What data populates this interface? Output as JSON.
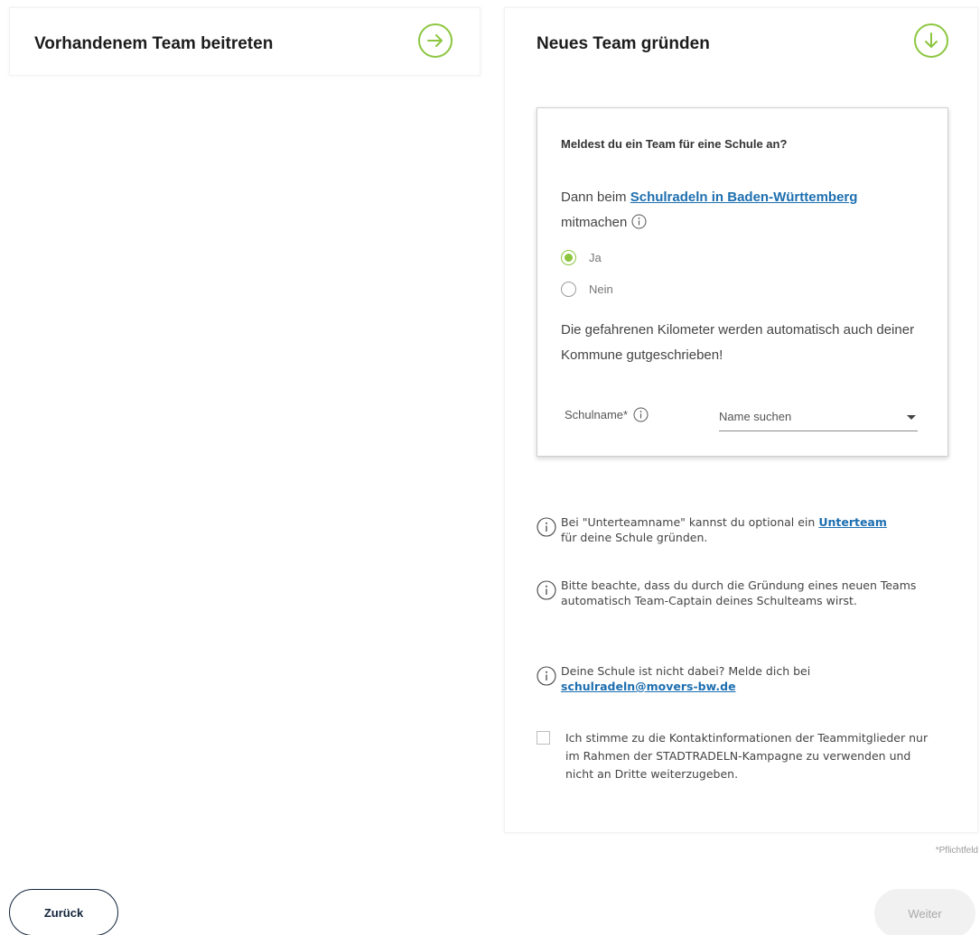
{
  "join_card": {
    "title": "Vorhandenem Team beitreten",
    "icon": "arrow-right-circle-icon"
  },
  "new_card": {
    "title": "Neues Team gründen",
    "icon": "arrow-down-circle-icon",
    "school_box": {
      "question": "Meldest du ein Team für eine Schule an?",
      "dann_prefix": "Dann beim",
      "dann_link": "Schulradeln in Baden-Württemberg",
      "dann_suffix": "mitmachen",
      "radio_options": [
        {
          "label": "Ja",
          "checked": true
        },
        {
          "label": "Nein",
          "checked": false
        }
      ],
      "km_text": "Die gefahrenen Kilometer werden automatisch auch deiner Kommune gutgeschrieben!",
      "school_label": "Schulname*",
      "school_placeholder": "Name suchen"
    },
    "notes": {
      "n1_prefix": "Bei \"Unterteamname\" kannst du optional ein",
      "n1_link": "Unterteam",
      "n1_suffix": "für deine Schule gründen.",
      "n2": "Bitte beachte, dass du durch die Gründung eines neuen Teams automatisch Team-Captain deines Schulteams wirst.",
      "n3_prefix": "Deine Schule ist nicht dabei? Melde dich bei",
      "n3_link": "schulradeln@movers-bw.de"
    },
    "consent": "Ich stimme zu die Kontaktinformationen der Teammitglieder nur im Rahmen der STADTRADELN-Kampagne zu verwenden und nicht an Dritte weiterzugeben."
  },
  "footer": {
    "required_note": "*Pflichtfeld",
    "back_label": "Zurück",
    "next_label": "Weiter"
  },
  "colors": {
    "accent_green": "#8cc63f",
    "link_blue": "#1d6fb0",
    "navy": "#12233a"
  }
}
